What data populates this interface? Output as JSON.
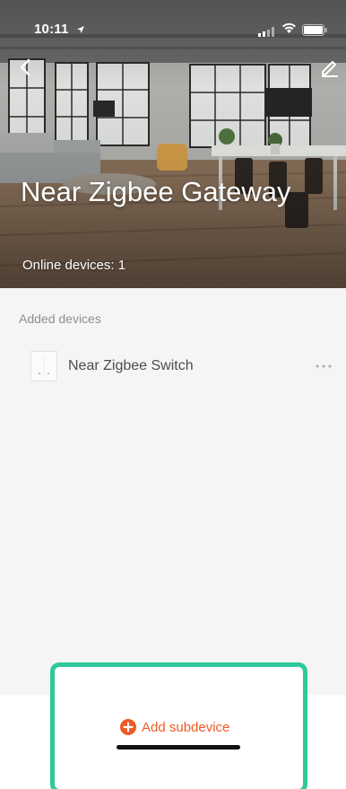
{
  "status_bar": {
    "time": "10:11",
    "location_icon": "location-arrow-icon",
    "signal_icon": "cellular-signal-icon",
    "wifi_icon": "wifi-icon",
    "battery_icon": "battery-icon"
  },
  "header": {
    "back_icon": "chevron-left-icon",
    "edit_icon": "pencil-icon",
    "title": "Near Zigbee Gateway",
    "online_devices": "Online devices: 1",
    "background": "room-interior-photo"
  },
  "devices_section": {
    "label": "Added devices",
    "items": [
      {
        "name": "Near Zigbee Switch",
        "thumbnail": "wall-switch-thumbnail",
        "more_icon": "more-horizontal-icon"
      }
    ]
  },
  "bottom_action": {
    "label": "Add subdevice",
    "icon": "plus-circle-icon"
  },
  "colors": {
    "accent": "#ee5a24",
    "highlight": "#2fc89b",
    "list_background": "#f5f5f5",
    "secondary_text": "#8e8e8e",
    "primary_text": "#4d4d4d"
  }
}
